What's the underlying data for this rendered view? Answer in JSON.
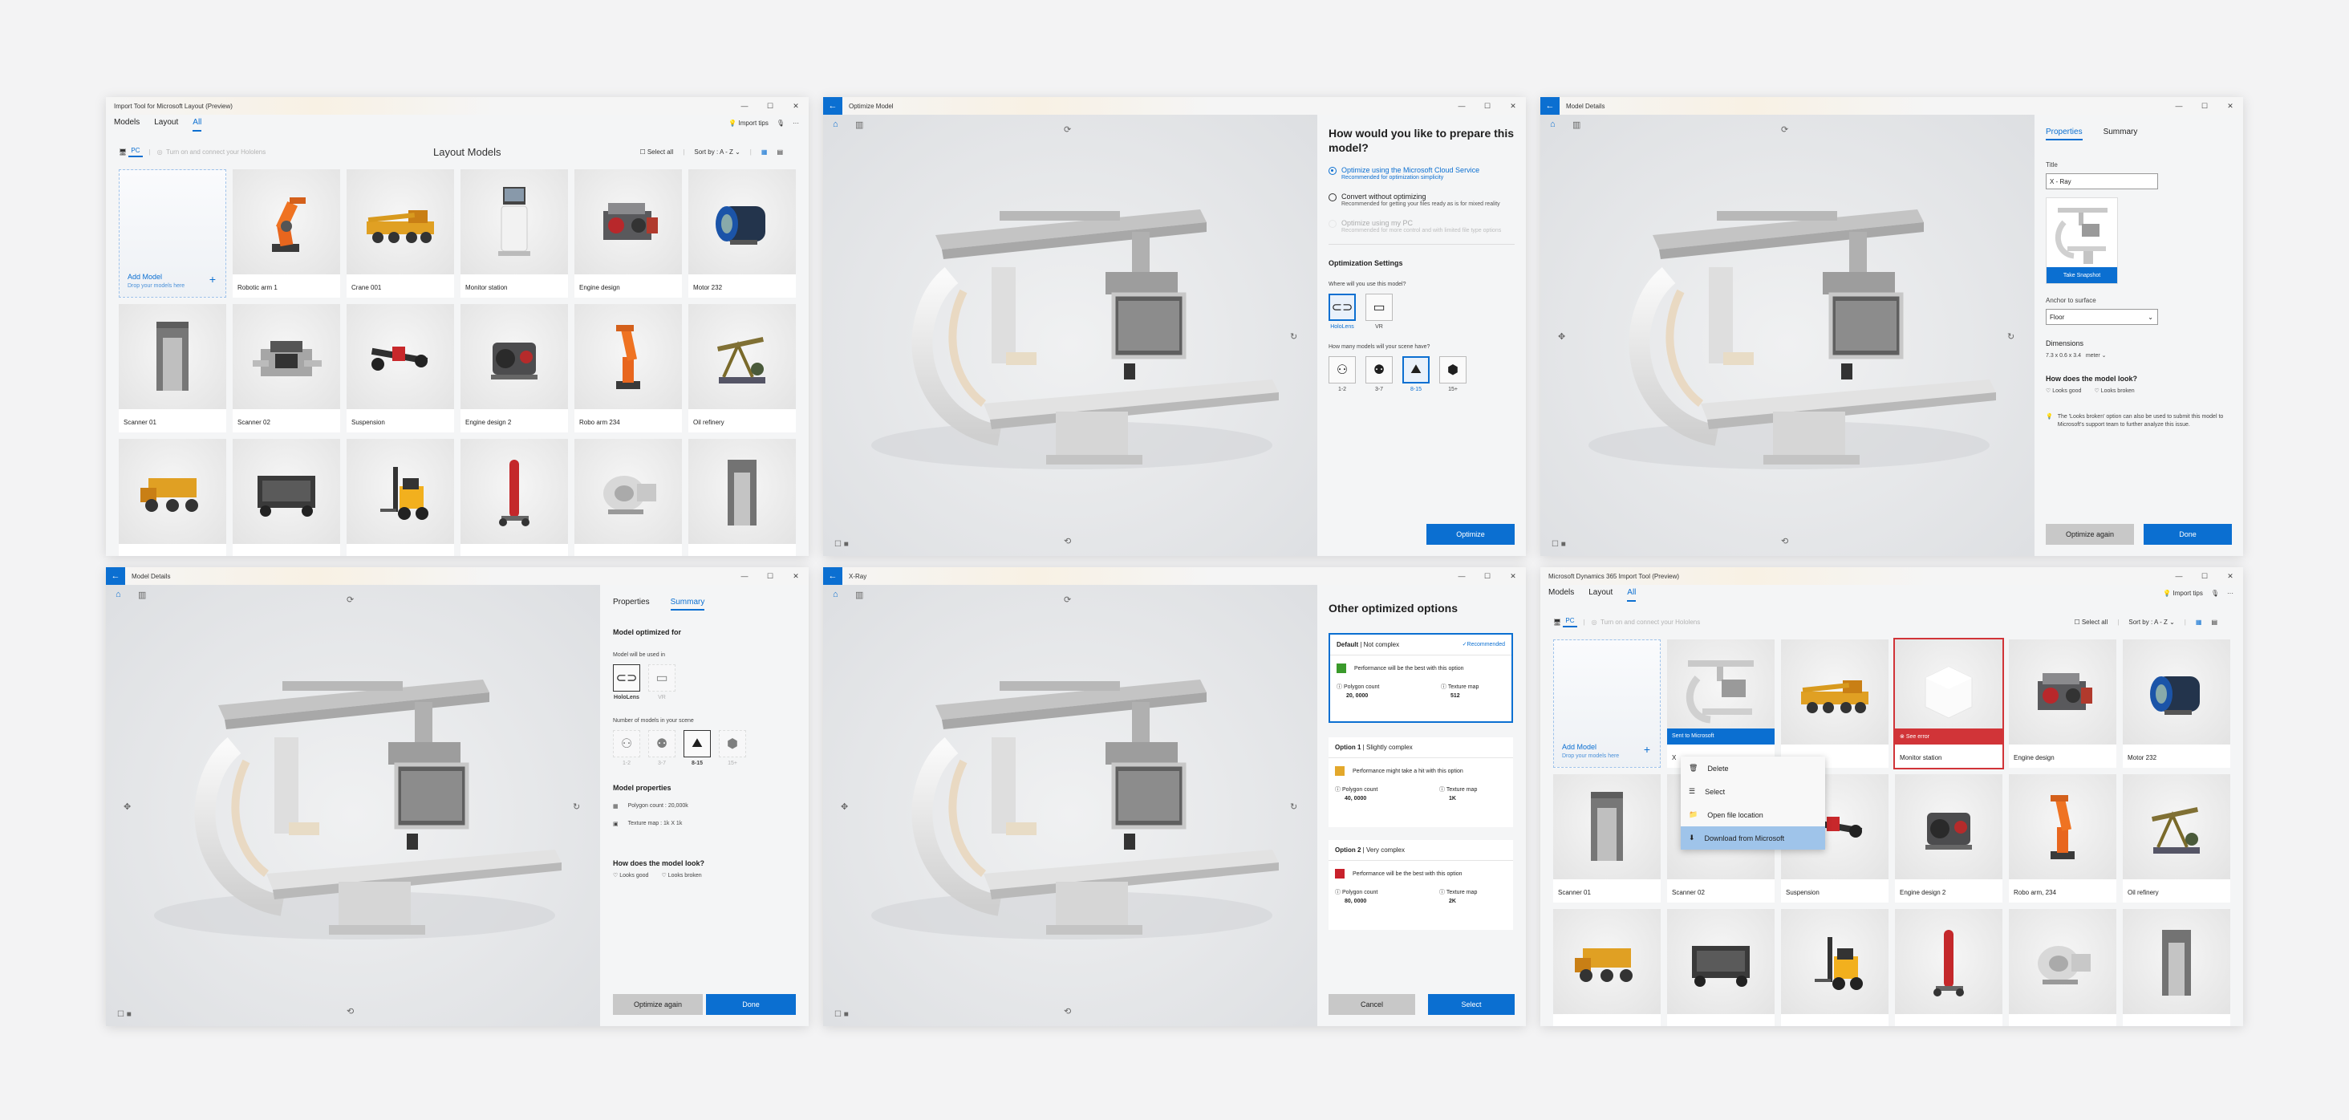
{
  "w1": {
    "title": "Import Tool for Microsoft Layout (Preview)",
    "tabs": [
      "Models",
      "Layout",
      "All"
    ],
    "import_tips": "Import tips",
    "pc": "PC",
    "hololens": "Turn on and connect your Hololens",
    "heading": "Layout Models",
    "select_all": "Select all",
    "sort": "Sort by : A - Z",
    "add_model": "Add Model",
    "drop": "Drop your models here",
    "models": [
      "Robotic arm 1",
      "Crane 001",
      "Monitor station",
      "Engine design",
      "Motor 232",
      "Scanner 01",
      "Scanner 02",
      "Suspension",
      "Engine design 2",
      "Robo arm 234",
      "Oil refinery",
      "",
      "",
      "",
      "",
      "",
      ""
    ]
  },
  "w2": {
    "title": "Optimize Model",
    "question": "How would you like to prepare this model?",
    "opt1_title": "Optimize using the Microsoft Cloud Service",
    "opt1_sub": "Recommended for optimization simplicity",
    "opt2_title": "Convert without optimizing",
    "opt2_sub": "Recommended for getting your files ready as is for mixed reality",
    "opt3_title": "Optimize using my PC",
    "opt3_sub": "Recommended for more control and with limited file type options",
    "settings": "Optimization Settings",
    "where": "Where will you use this model?",
    "devices": [
      "HoloLens",
      "VR"
    ],
    "howmany": "How many models will your scene have?",
    "counts": [
      "1-2",
      "3-7",
      "8-15",
      "15+"
    ],
    "button": "Optimize"
  },
  "w3": {
    "title": "Model Details",
    "tabs": [
      "Properties",
      "Summary"
    ],
    "title_label": "Title",
    "title_value": "X - Ray",
    "snapshot": "Take Snapshot",
    "anchor": "Anchor to surface",
    "anchor_value": "Floor",
    "dimensions": "Dimensions",
    "dim_value": "7.3 x 0.6 x 3.4",
    "dim_unit": "meter",
    "look": "How does the model look?",
    "good": "Looks good",
    "broken": "Looks broken",
    "info": "The 'Looks broken' option can also be used to submit this model to Microsoft's support team to further analyze this issue.",
    "again": "Optimize again",
    "done": "Done"
  },
  "w4": {
    "title": "Model Details",
    "tabs": [
      "Properties",
      "Summary"
    ],
    "optimized_for": "Model optimized for",
    "used_in": "Model will be used in",
    "devices": [
      "HoloLens",
      "VR"
    ],
    "num_models": "Number of models in your scene",
    "counts": [
      "1-2",
      "3-7",
      "8-15",
      "15+"
    ],
    "props": "Model properties",
    "poly": "Polygon count : 20,000k",
    "tex": "Texture map : 1k X 1k",
    "look": "How does the model look?",
    "good": "Looks good",
    "broken": "Looks broken",
    "again": "Optimize again",
    "done": "Done"
  },
  "w5": {
    "title": "X-Ray",
    "heading": "Other optimized options",
    "poly_label": "Polygon count",
    "tex_label": "Texture map",
    "options": [
      {
        "name": "Default",
        "level": "Not complex",
        "badge": "Recommended",
        "perf": "Performance will be the best with this option",
        "poly": "20, 0000",
        "tex": "512",
        "color": "#3a9a2b"
      },
      {
        "name": "Option 1",
        "level": "Slightly complex",
        "badge": "",
        "perf": "Performance might take a hit with this option",
        "poly": "40, 0000",
        "tex": "1K",
        "color": "#e3a82b"
      },
      {
        "name": "Option 2",
        "level": "Very complex",
        "badge": "",
        "perf": "Performance will be the best with this option",
        "poly": "80, 0000",
        "tex": "2K",
        "color": "#c8212b"
      }
    ],
    "cancel": "Cancel",
    "select": "Select"
  },
  "w6": {
    "title": "Microsoft Dynamics 365 Import Tool (Preview)",
    "tabs": [
      "Models",
      "Layout",
      "All"
    ],
    "import_tips": "Import tips",
    "pc": "PC",
    "hololens": "Turn on and connect your Hololens",
    "select_all": "Select all",
    "sort": "Sort by : A - Z",
    "add_model": "Add Model",
    "drop": "Drop your models here",
    "sent": "Sent to Microsoft",
    "see_error": "See error",
    "models": [
      "X",
      "",
      "Monitor station",
      "Engine design",
      "Motor 232",
      "Scanner 01",
      "Scanner 02",
      "Suspension",
      "Engine design 2",
      "Robo arm, 234",
      "Oil refinery",
      "",
      "",
      "",
      "",
      "",
      ""
    ],
    "menu": [
      "Delete",
      "Select",
      "Open file location",
      "Download from Microsoft"
    ]
  }
}
